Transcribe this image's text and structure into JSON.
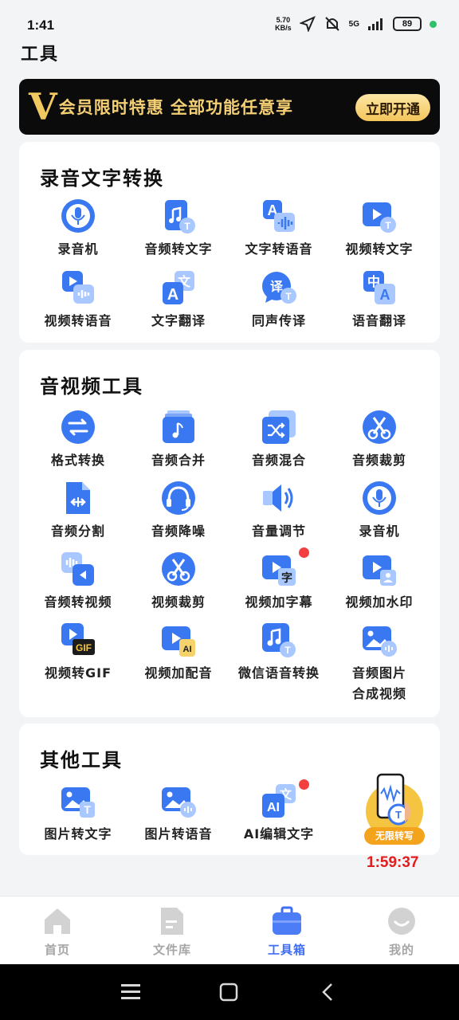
{
  "status": {
    "time": "1:41",
    "net_speed_value": "5.70",
    "net_speed_unit": "KB/s",
    "signal": "5G",
    "battery": "89"
  },
  "page_title": "工具",
  "vip": {
    "badge": "V",
    "text": "会员限时特惠  全部功能任意享",
    "button": "立即开通"
  },
  "sections": {
    "s0": {
      "title": "录音文字转换",
      "items": [
        "录音机",
        "音频转文字",
        "文字转语音",
        "视频转文字",
        "视频转语音",
        "文字翻译",
        "同声传译",
        "语音翻译"
      ]
    },
    "s1": {
      "title": "音视频工具",
      "items": [
        "格式转换",
        "音频合并",
        "音频混合",
        "音频裁剪",
        "音频分割",
        "音频降噪",
        "音量调节",
        "录音机",
        "音频转视频",
        "视频裁剪",
        "视频加字幕",
        "视频加水印",
        "视频转GIF",
        "视频加配音",
        "微信语音转换",
        "音频图片\n合成视频"
      ]
    },
    "s2": {
      "title": "其他工具",
      "items": [
        "图片转文字",
        "图片转语音",
        "AI编辑文字"
      ]
    }
  },
  "promo": {
    "label": "无限转写",
    "countdown": "1:59:37"
  },
  "bottom_nav": [
    "首页",
    "文件库",
    "工具箱",
    "我的"
  ],
  "icons": {
    "s0": [
      "mic-icon",
      "audio-to-text-icon",
      "text-to-speech-icon",
      "video-to-text-icon",
      "video-to-speech-icon",
      "text-translate-icon",
      "simultaneous-interpretation-icon",
      "speech-translate-icon"
    ],
    "s1": [
      "format-convert-icon",
      "audio-merge-icon",
      "audio-mix-icon",
      "audio-cut-icon",
      "audio-split-icon",
      "noise-reduction-icon",
      "volume-adjust-icon",
      "mic-icon",
      "audio-to-video-icon",
      "video-cut-icon",
      "subtitle-icon",
      "watermark-icon",
      "gif-icon",
      "dubbing-icon",
      "wechat-voice-icon",
      "image-audio-video-icon"
    ],
    "s2": [
      "image-to-text-icon",
      "image-to-speech-icon",
      "ai-edit-icon"
    ]
  },
  "colors": {
    "accent": "#3f6ef5",
    "icon_blue": "#3a78f2",
    "icon_light": "#a9c8ff",
    "vip_gold": "#f4cf73",
    "badge_red": "#f24040"
  }
}
